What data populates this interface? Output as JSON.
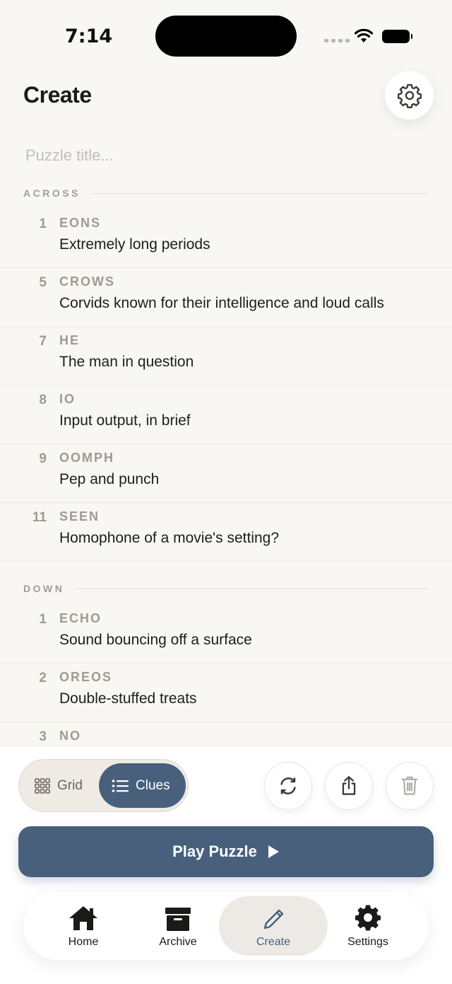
{
  "status_bar": {
    "time": "7:14"
  },
  "header": {
    "title": "Create",
    "settings_icon": "gear-icon"
  },
  "title_input": {
    "placeholder": "Puzzle title...",
    "value": ""
  },
  "across": {
    "label": "ACROSS",
    "clues": [
      {
        "number": "1",
        "answer": "EONS",
        "text": "Extremely long periods"
      },
      {
        "number": "5",
        "answer": "CROWS",
        "text": "Corvids known for their intelligence and loud calls"
      },
      {
        "number": "7",
        "answer": "HE",
        "text": "The man in question"
      },
      {
        "number": "8",
        "answer": "IO",
        "text": "Input output, in brief"
      },
      {
        "number": "9",
        "answer": "OOMPH",
        "text": "Pep and punch"
      },
      {
        "number": "11",
        "answer": "SEEN",
        "text": "Homophone of a movie's setting?"
      }
    ]
  },
  "down": {
    "label": "DOWN",
    "clues": [
      {
        "number": "1",
        "answer": "ECHO",
        "text": "Sound bouncing off a surface"
      },
      {
        "number": "2",
        "answer": "OREOS",
        "text": "Double-stuffed treats"
      },
      {
        "number": "3",
        "answer": "NO",
        "text": ""
      }
    ]
  },
  "toolbar": {
    "grid_label": "Grid",
    "clues_label": "Clues",
    "selected_view": "Clues",
    "icons": [
      "refresh-icon",
      "share-icon",
      "trash-icon"
    ]
  },
  "play_button": {
    "label": "Play Puzzle"
  },
  "tab_bar": {
    "active": "Create",
    "tabs": [
      {
        "label": "Home",
        "icon": "home-icon"
      },
      {
        "label": "Archive",
        "icon": "archive-box-icon"
      },
      {
        "label": "Create",
        "icon": "pencil-icon"
      },
      {
        "label": "Settings",
        "icon": "gear-icon"
      }
    ]
  },
  "colors": {
    "background": "#f9f7f3",
    "accent": "#48607c",
    "muted_text": "#9e9a93"
  }
}
